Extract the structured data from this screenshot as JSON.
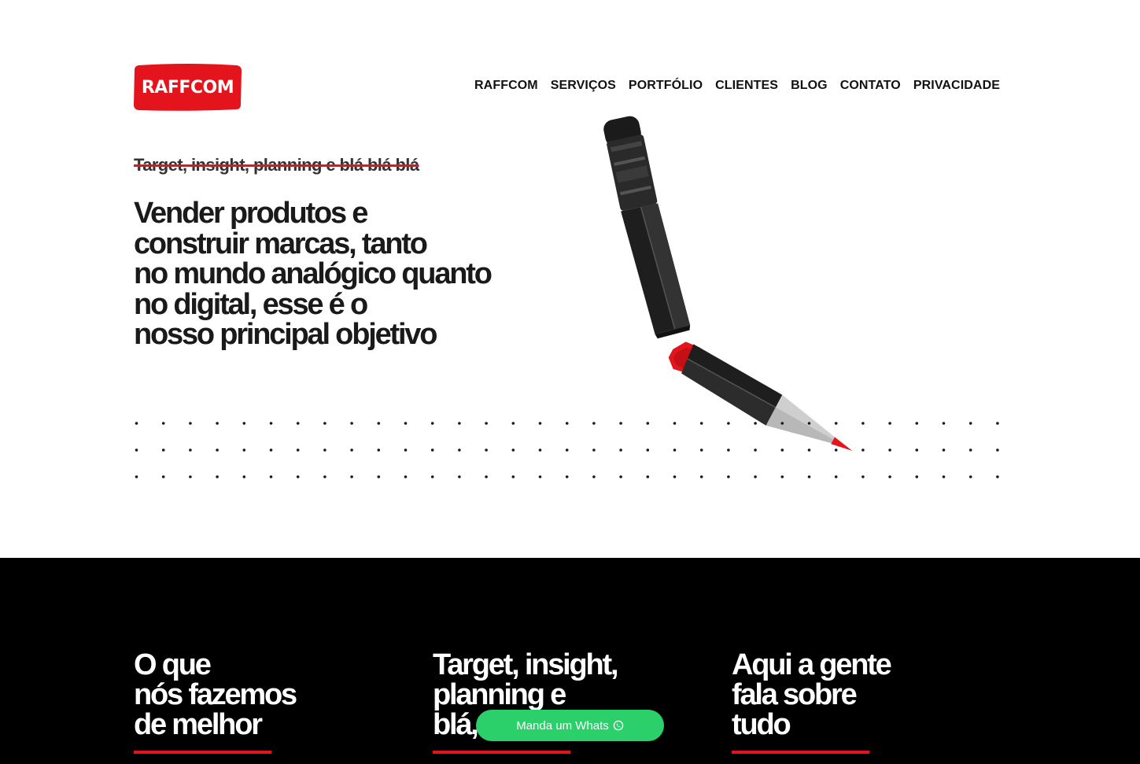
{
  "brand": {
    "logo_text": "RAFFCOM",
    "accent": "#e3141b"
  },
  "nav": {
    "items": [
      {
        "label": "RAFFCOM"
      },
      {
        "label": "SERVIÇOS"
      },
      {
        "label": "PORTFÓLIO"
      },
      {
        "label": "CLIENTES"
      },
      {
        "label": "BLOG"
      },
      {
        "label": "CONTATO"
      },
      {
        "label": "PRIVACIDADE"
      }
    ]
  },
  "hero": {
    "struck_text": "Target, insight, planning e blá blá blá",
    "title_lines": [
      "Vender produtos e",
      "construir marcas, tanto",
      "no mundo analógico quanto",
      "no digital, esse é o",
      "nosso principal objetivo"
    ]
  },
  "sections": [
    {
      "title_lines": [
        "O que",
        "nós fazemos",
        "de melhor"
      ]
    },
    {
      "title_lines": [
        "Target, insight,",
        "planning e",
        "blá, blá, blá"
      ]
    },
    {
      "title_lines": [
        "Aqui a gente",
        "fala sobre",
        "tudo"
      ]
    }
  ],
  "whatsapp": {
    "label": "Manda um Whats",
    "color": "#2bd06a",
    "icon": "whatsapp-icon"
  }
}
